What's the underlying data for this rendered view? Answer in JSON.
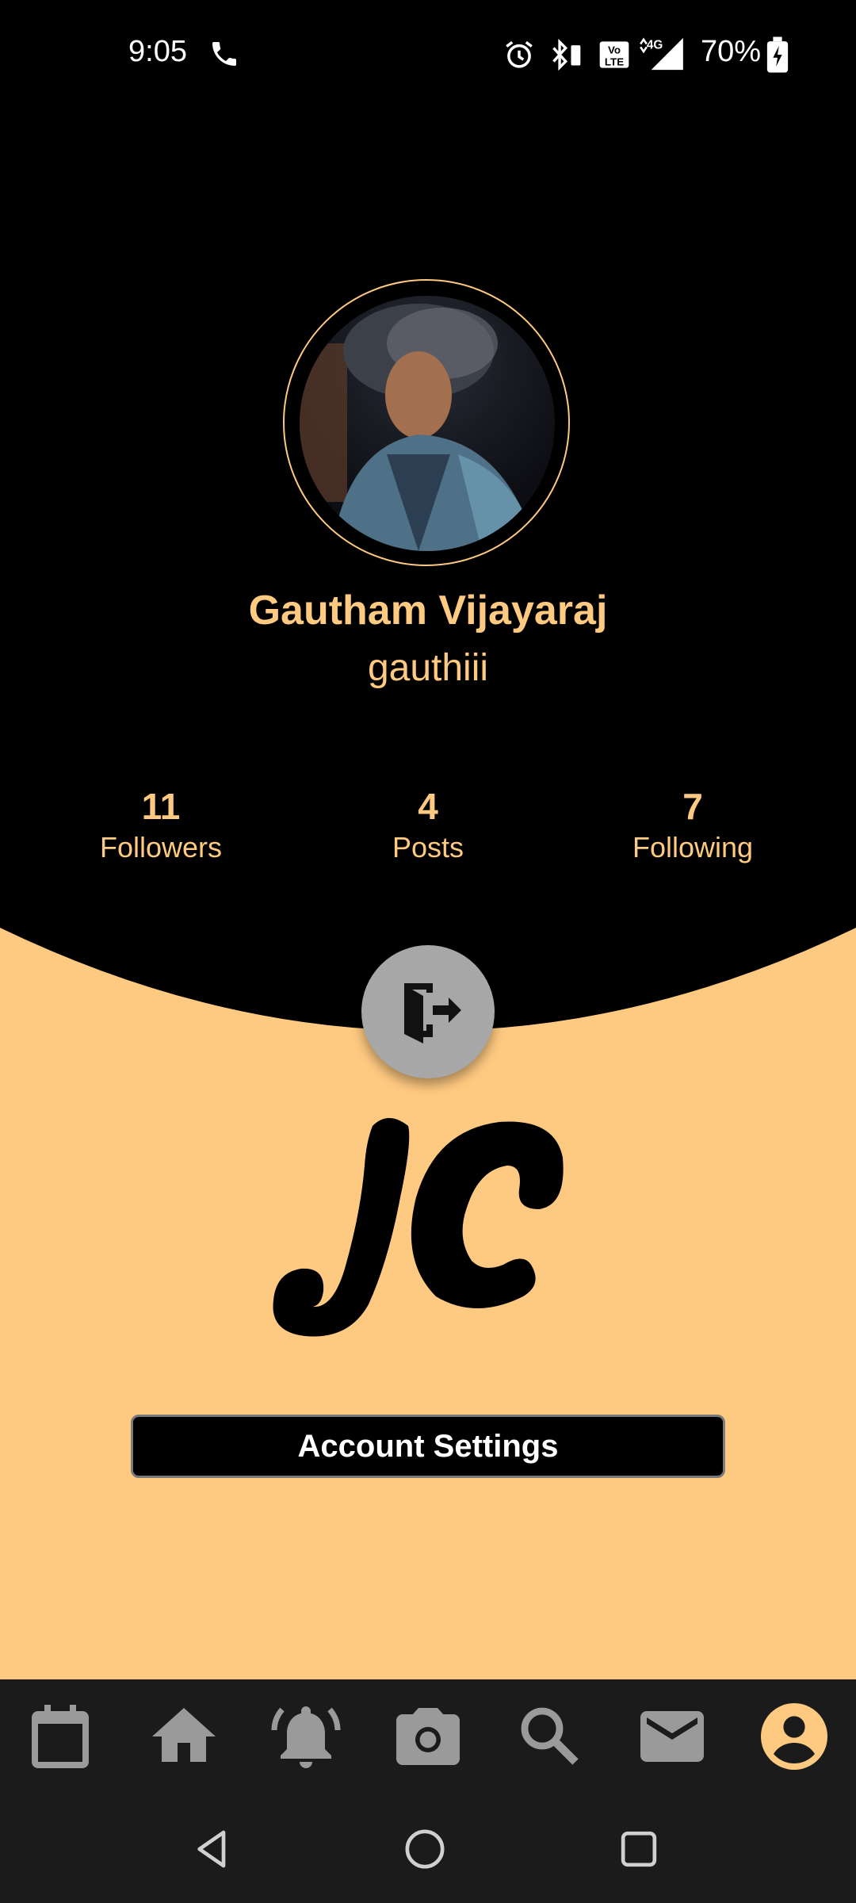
{
  "status_bar": {
    "time": "9:05",
    "battery_percent": "70%",
    "icons": [
      "phone-icon",
      "alarm-icon",
      "bluetooth-icon",
      "volte-icon",
      "4g-signal-icon",
      "battery-charging-icon"
    ]
  },
  "profile": {
    "display_name": "Gautham Vijayaraj",
    "username": "gauthiii"
  },
  "stats": {
    "followers_count": "11",
    "followers_label": "Followers",
    "posts_count": "4",
    "posts_label": "Posts",
    "following_count": "7",
    "following_label": "Following"
  },
  "actions": {
    "logout_icon": "logout-icon",
    "account_settings_label": "Account Settings"
  },
  "logo": {
    "text": "JC"
  },
  "bottom_tabs": {
    "items": [
      "calendar-icon",
      "home-icon",
      "notifications-icon",
      "camera-icon",
      "search-icon",
      "mail-icon",
      "account-icon"
    ],
    "active": "account-icon"
  },
  "system_nav": {
    "items": [
      "back-icon",
      "home-circle-icon",
      "recents-icon"
    ]
  },
  "colors": {
    "accent": "#fec980",
    "background_top": "#000000",
    "tab_inactive": "#9a9a9a",
    "tab_bar": "#1b1b1b"
  }
}
